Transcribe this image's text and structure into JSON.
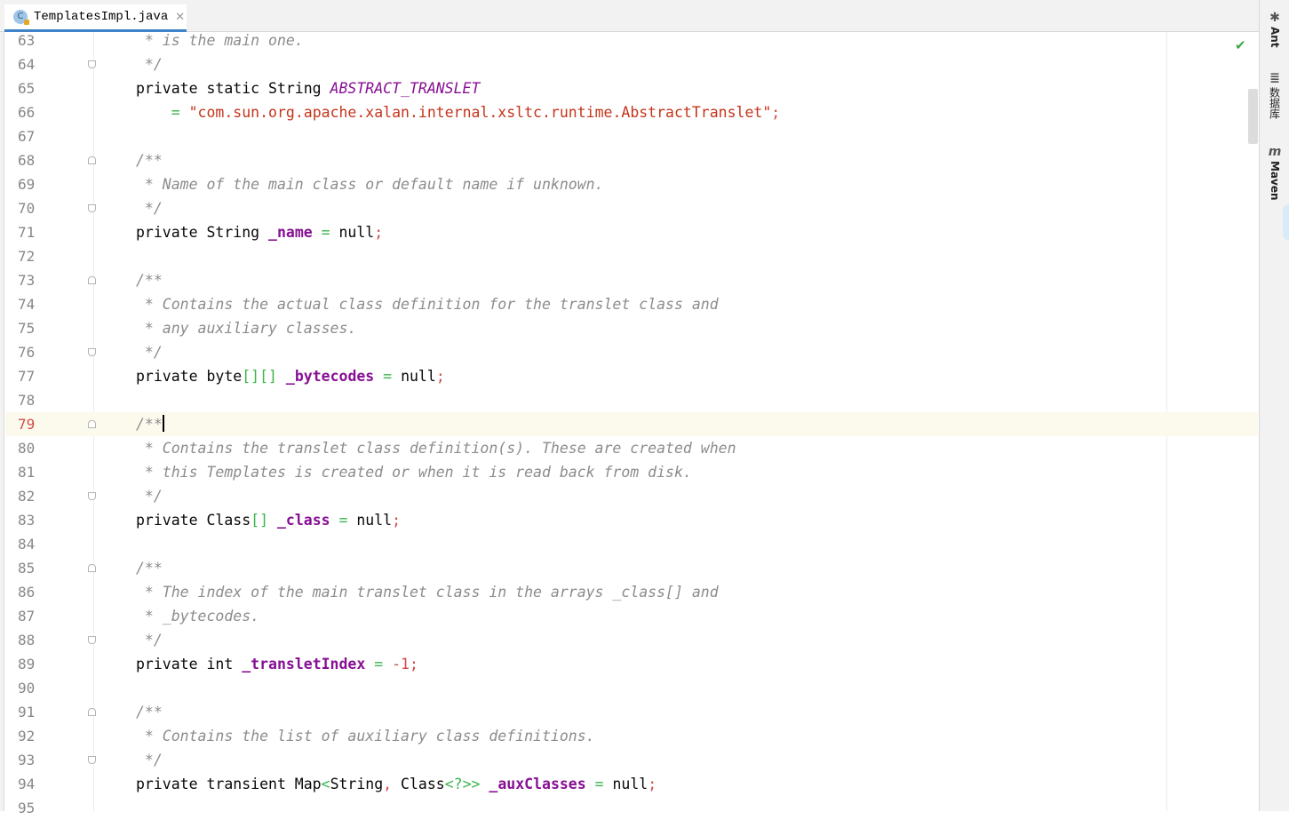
{
  "tab": {
    "icon_letter": "C",
    "filename": "TemplatesImpl.java",
    "close_glyph": "✕"
  },
  "editor": {
    "current_line": 79,
    "lines": [
      {
        "n": "63",
        "parts": [
          [
            "cm",
            " * is the main one."
          ]
        ]
      },
      {
        "n": "64",
        "parts": [
          [
            "cm",
            " */"
          ]
        ]
      },
      {
        "n": "65",
        "parts": [
          [
            "kw",
            "private static String "
          ],
          [
            "const",
            "ABSTRACT_TRANSLET"
          ]
        ]
      },
      {
        "n": "66",
        "parts": [
          [
            "kw",
            "    "
          ],
          [
            "op",
            "= "
          ],
          [
            "str",
            "\"com.sun.org.apache.xalan.internal.xsltc.runtime.AbstractTranslet\""
          ],
          [
            "semi",
            ";"
          ]
        ]
      },
      {
        "n": "67",
        "parts": []
      },
      {
        "n": "68",
        "parts": [
          [
            "cm",
            "/**"
          ]
        ]
      },
      {
        "n": "69",
        "parts": [
          [
            "cm",
            " * Name of the main class or default name if unknown."
          ]
        ]
      },
      {
        "n": "70",
        "parts": [
          [
            "cm",
            " */"
          ]
        ]
      },
      {
        "n": "71",
        "parts": [
          [
            "kw",
            "private String "
          ],
          [
            "fld",
            "_name"
          ],
          [
            "op",
            " = "
          ],
          [
            "kw",
            "null"
          ],
          [
            "semi",
            ";"
          ]
        ]
      },
      {
        "n": "72",
        "parts": []
      },
      {
        "n": "73",
        "parts": [
          [
            "cm",
            "/**"
          ]
        ]
      },
      {
        "n": "74",
        "parts": [
          [
            "cm",
            " * Contains the actual class definition for the translet class and"
          ]
        ]
      },
      {
        "n": "75",
        "parts": [
          [
            "cm",
            " * any auxiliary classes."
          ]
        ]
      },
      {
        "n": "76",
        "parts": [
          [
            "cm",
            " */"
          ]
        ]
      },
      {
        "n": "77",
        "parts": [
          [
            "kw",
            "private byte"
          ],
          [
            "op",
            "[][]"
          ],
          [
            "kw",
            " "
          ],
          [
            "fld",
            "_bytecodes"
          ],
          [
            "op",
            " = "
          ],
          [
            "kw",
            "null"
          ],
          [
            "semi",
            ";"
          ]
        ]
      },
      {
        "n": "78",
        "parts": []
      },
      {
        "n": "79",
        "parts": [
          [
            "cm",
            "/**"
          ]
        ]
      },
      {
        "n": "80",
        "parts": [
          [
            "cm",
            " * Contains the translet class definition(s). These are created when"
          ]
        ]
      },
      {
        "n": "81",
        "parts": [
          [
            "cm",
            " * this Templates is created or when it is read back from disk."
          ]
        ]
      },
      {
        "n": "82",
        "parts": [
          [
            "cm",
            " */"
          ]
        ]
      },
      {
        "n": "83",
        "parts": [
          [
            "kw",
            "private Class"
          ],
          [
            "op",
            "[]"
          ],
          [
            "kw",
            " "
          ],
          [
            "fld",
            "_class"
          ],
          [
            "op",
            " = "
          ],
          [
            "kw",
            "null"
          ],
          [
            "semi",
            ";"
          ]
        ]
      },
      {
        "n": "84",
        "parts": []
      },
      {
        "n": "85",
        "parts": [
          [
            "cm",
            "/**"
          ]
        ]
      },
      {
        "n": "86",
        "parts": [
          [
            "cm",
            " * The index of the main translet class in the arrays _class[] and"
          ]
        ]
      },
      {
        "n": "87",
        "parts": [
          [
            "cm",
            " * _bytecodes."
          ]
        ]
      },
      {
        "n": "88",
        "parts": [
          [
            "cm",
            " */"
          ]
        ]
      },
      {
        "n": "89",
        "parts": [
          [
            "kw",
            "private int "
          ],
          [
            "fld",
            "_transletIndex"
          ],
          [
            "op",
            " = "
          ],
          [
            "num",
            "-1"
          ],
          [
            "semi",
            ";"
          ]
        ]
      },
      {
        "n": "90",
        "parts": []
      },
      {
        "n": "91",
        "parts": [
          [
            "cm",
            "/**"
          ]
        ]
      },
      {
        "n": "92",
        "parts": [
          [
            "cm",
            " * Contains the list of auxiliary class definitions."
          ]
        ]
      },
      {
        "n": "93",
        "parts": [
          [
            "cm",
            " */"
          ]
        ]
      },
      {
        "n": "94",
        "parts": [
          [
            "kw",
            "private transient Map"
          ],
          [
            "op",
            "<"
          ],
          [
            "kw",
            "String"
          ],
          [
            "semi",
            ", "
          ],
          [
            "kw",
            "Class"
          ],
          [
            "op",
            "<?>>"
          ],
          [
            "kw",
            " "
          ],
          [
            "fld",
            "_auxClasses"
          ],
          [
            "op",
            " = "
          ],
          [
            "kw",
            "null"
          ],
          [
            "semi",
            ";"
          ]
        ]
      },
      {
        "n": "95",
        "parts": []
      }
    ]
  },
  "status": {
    "inspection_icon": "check-icon"
  },
  "tool_windows": [
    {
      "icon": "ant-icon",
      "icon_glyph": "✱",
      "label": "Ant"
    },
    {
      "icon": "database-icon",
      "icon_glyph": "≣",
      "label": "数据库"
    },
    {
      "icon": "maven-icon",
      "icon_glyph": "m",
      "label": "Maven"
    }
  ],
  "colors": {
    "accent": "#4083c9",
    "current_line_bg": "#fcfaed",
    "field": "#871094",
    "string": "#c5341b",
    "comment": "#8c8c8c"
  }
}
